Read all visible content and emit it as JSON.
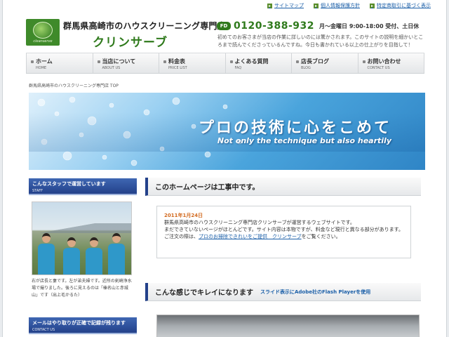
{
  "top_links": [
    {
      "label": "サイトマップ"
    },
    {
      "label": "個人情報保護方針"
    },
    {
      "label": "特定商取引に基づく表示"
    }
  ],
  "header": {
    "logo_text": "cleanserve",
    "site_title": "群馬県高崎市のハウスクリーニング専門店",
    "brand": "クリンサーブ",
    "phone_icon": "フリーダイヤル",
    "phone": "0120-388-932",
    "hours": "月～金曜日 9:00-18:00 受付、土日休",
    "intro": "初めてのお客さまが当店の作業に詳しいのには驚かされます。このサイトの説明を細かいところまで読んでくださっているんですね。今日も書かれている以上の仕上がりを目指して！"
  },
  "nav": [
    {
      "ja": "ホーム",
      "en": "HOME"
    },
    {
      "ja": "当店について",
      "en": "ABOUT US"
    },
    {
      "ja": "料金表",
      "en": "PRICE LIST"
    },
    {
      "ja": "よくある質問",
      "en": "FAQ"
    },
    {
      "ja": "店長ブログ",
      "en": "BLOG"
    },
    {
      "ja": "お問い合わせ",
      "en": "CONTACT US"
    }
  ],
  "breadcrumb": "群馬県高崎市のハウスクリーニング専門店 TOP",
  "hero": {
    "jp": "プロの技術に心をこめて",
    "en": "Not only the technique but also heartily"
  },
  "sidebar": {
    "staff_title": "こんなスタッフで運営しています",
    "staff_sub": "STAFF",
    "staff_text": "右が店長と妻です。左が弟夫婦です。近所の剣崎浄水場で撮りました。後ろに見えるのは「榛名山と赤城山」です（出上毛かるた）",
    "contact_title": "メールはやり取りが正確で記録が残ります",
    "contact_sub": "CONTACT US"
  },
  "main": {
    "section1_title": "このホームページは工事中です。",
    "notice_date": "2011年1月24日",
    "notice_line1": "群馬県高崎市のハウスクリーニング専門店クリンサーブが運営するウェブサイトです。",
    "notice_line2": "まだできていないページがほとんどです。サイト内容は本物ですが、料金など現行と異なる部分があります。",
    "notice_line3_pre": "ご注文の際は、",
    "notice_link": "プロのお掃除できれいをご提供　クリンサーブ",
    "notice_line3_post": "をご覧ください。",
    "section2_title": "こんな感じでキレイになります",
    "section2_sub": "スライド表示にAdobe社のFlash Playerを使用"
  }
}
